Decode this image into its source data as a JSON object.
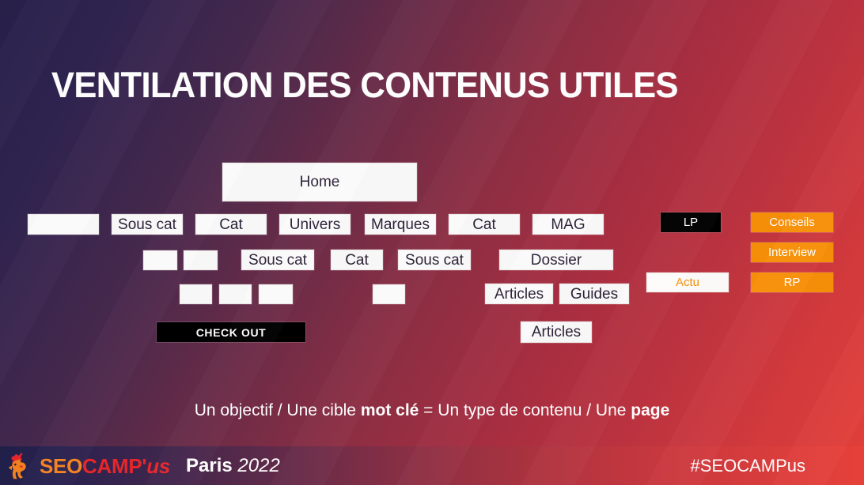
{
  "slide": {
    "title": "VENTILATION DES CONTENUS UTILES",
    "caption": {
      "part1": "Un objectif / Une cible ",
      "bold1": "mot clé",
      "part2": " = Un type de contenu / Une ",
      "bold2": "page"
    }
  },
  "diagram": {
    "root": {
      "label": "Home"
    },
    "nodes": [
      {
        "label": "",
        "style": "white"
      },
      {
        "label": "Sous cat",
        "style": "white"
      },
      {
        "label": "Cat",
        "style": "white"
      },
      {
        "label": "Univers",
        "style": "white"
      },
      {
        "label": "Marques",
        "style": "white"
      },
      {
        "label": "Cat",
        "style": "white"
      },
      {
        "label": "MAG",
        "style": "white"
      },
      {
        "label": "LP",
        "style": "black"
      },
      {
        "label": "Conseils",
        "style": "orange"
      },
      {
        "label": "",
        "style": "white"
      },
      {
        "label": "",
        "style": "white"
      },
      {
        "label": "Sous cat",
        "style": "white"
      },
      {
        "label": "Cat",
        "style": "white"
      },
      {
        "label": "Sous cat",
        "style": "white"
      },
      {
        "label": "Dossier",
        "style": "white"
      },
      {
        "label": "Interview",
        "style": "orange"
      },
      {
        "label": "",
        "style": "white"
      },
      {
        "label": "",
        "style": "white"
      },
      {
        "label": "",
        "style": "white"
      },
      {
        "label": "",
        "style": "white"
      },
      {
        "label": "Articles",
        "style": "white"
      },
      {
        "label": "Guides",
        "style": "white"
      },
      {
        "label": "Actu",
        "style": "white-orange"
      },
      {
        "label": "RP",
        "style": "orange"
      },
      {
        "label": "CHECK OUT",
        "style": "black-bold"
      },
      {
        "label": "Articles",
        "style": "white"
      }
    ]
  },
  "footer": {
    "brand_seo": "SEO",
    "brand_camp": "CAMP'",
    "brand_us": "us",
    "city": "Paris",
    "year": "2022",
    "hashtag": "#SEOCAMPus",
    "logo_icon": "rooster-icon"
  },
  "colors": {
    "accent_orange": "#f79009",
    "brand_orange": "#f4821f",
    "brand_red": "#e8262b",
    "bg_start": "#272049",
    "bg_end": "#e54039",
    "node_bg": "#fbfafa",
    "black": "#000000"
  }
}
